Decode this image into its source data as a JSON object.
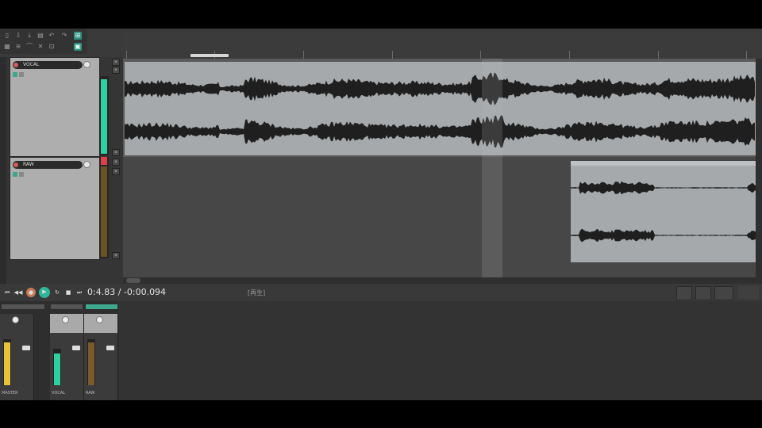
{
  "toolbar": {
    "icons": [
      "new-icon",
      "open-icon",
      "save-icon",
      "settings-icon",
      "undo-icon",
      "redo-icon",
      "snap-icon",
      "grid-icon",
      "ripple-icon",
      "envelope-icon",
      "lock-icon",
      "crossfade-icon"
    ]
  },
  "ruler": {
    "ticks": [
      "",
      "",
      "",
      "",
      "",
      "",
      "",
      ""
    ]
  },
  "tracks": [
    {
      "name": "VOCAL",
      "fx_label": "",
      "meter_color": "#2fd0a0",
      "level": 0.8
    },
    {
      "name": "RAW",
      "fx_label": "",
      "meter_color": "#b07a2a",
      "level": 0.0
    }
  ],
  "items": {
    "item1_title": "",
    "item2_title": ""
  },
  "transport": {
    "time": "0:4.83 / -0:00.094",
    "status": "[再生]",
    "info": [
      "",
      "",
      "",
      ""
    ]
  },
  "mixer": {
    "strips": [
      {
        "name": "MASTER",
        "meter_color": "#e6c43a"
      },
      {
        "name": "VOCAL",
        "meter_color": "#2fd0a0"
      },
      {
        "name": "RAW",
        "meter_color": "#b07a2a"
      }
    ]
  },
  "colors": {
    "accent": "#2fb59a",
    "record": "#d65a5a",
    "waveform": "#1f1f1f",
    "item_bg": "#a5a9ab"
  }
}
